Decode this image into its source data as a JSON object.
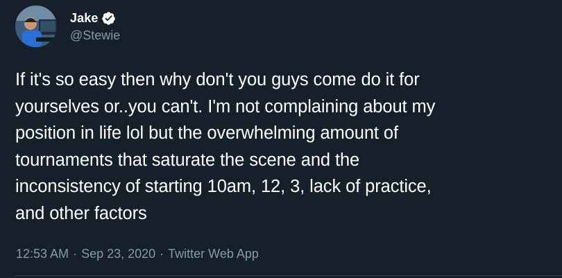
{
  "tweet": {
    "author": {
      "display_name": "Jake",
      "handle": "@Stewie",
      "verified_icon": "verified-badge-icon"
    },
    "text": "If it's so easy then why don't you guys come do it for\nyourselves or..you can't. I'm not complaining about my\nposition in life lol but the overwhelming amount of\ntournaments that saturate the scene and the\ninconsistency of starting 10am, 12, 3, lack of practice,\nand other factors",
    "time": "12:53 AM",
    "separator": "·",
    "date": "Sep 23, 2020",
    "source": "Twitter Web App"
  },
  "colors": {
    "background": "#15202b",
    "text_primary": "#ffffff",
    "text_secondary": "#8899a6",
    "verified_badge": "#ffffff",
    "divider": "#38444d"
  }
}
